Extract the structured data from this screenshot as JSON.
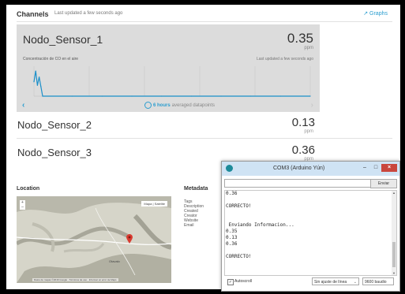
{
  "channels": {
    "title": "Channels",
    "updated": "Last updated a few seconds ago",
    "graphs_label": "Graphs"
  },
  "sensor1": {
    "name": "Nodo_Sensor_1",
    "value": "0.35",
    "unit": "ppm",
    "description": "Concentración de CO en el aire",
    "updated": "Last updated a few seconds ago",
    "range_label": "6 hours",
    "range_suffix": "averaged datapoints",
    "chart_data": {
      "type": "line",
      "color": "#1a8fc9",
      "y": [
        0.24,
        0.42,
        0.18,
        0.32,
        0.16,
        0.0,
        0.0,
        0.0,
        0.0,
        0.0,
        0.0,
        0.0,
        0.0,
        0.0,
        0.0
      ],
      "ylim": [
        0,
        0.5
      ]
    }
  },
  "sensor2": {
    "name": "Nodo_Sensor_2",
    "value": "0.13",
    "unit": "ppm"
  },
  "sensor3": {
    "name": "Nodo_Sensor_3",
    "value": "0.36",
    "unit": "ppm"
  },
  "location": {
    "title": "Location",
    "map_type": "Mapa | Satélite",
    "zoom_in": "+",
    "zoom_out": "–",
    "town": "Otavalo",
    "attribution": "Datos de mapas ©2016 Google · Términos de uso · Informar un error de Maps"
  },
  "metadata": {
    "title": "Metadata",
    "fields": [
      "Tags",
      "Description",
      "Created",
      "Creator",
      "Website",
      "Email"
    ]
  },
  "serial": {
    "title": "COM3 (Arduino Yún)",
    "min_label": "–",
    "max_label": "□",
    "close_label": "×",
    "input_value": "",
    "send_label": "Enviar",
    "lines": [
      "0.36",
      "",
      "CORRECTO!",
      "",
      "",
      " Enviando Informacion...",
      "0.35",
      "0.13",
      "0.36",
      "",
      "CORRECTO!",
      ""
    ],
    "autoscroll_label": "Autoscroll",
    "autoscroll_checked": "✓",
    "line_ending": "Sin ajuste de línea",
    "baud": "9600 baudio"
  }
}
